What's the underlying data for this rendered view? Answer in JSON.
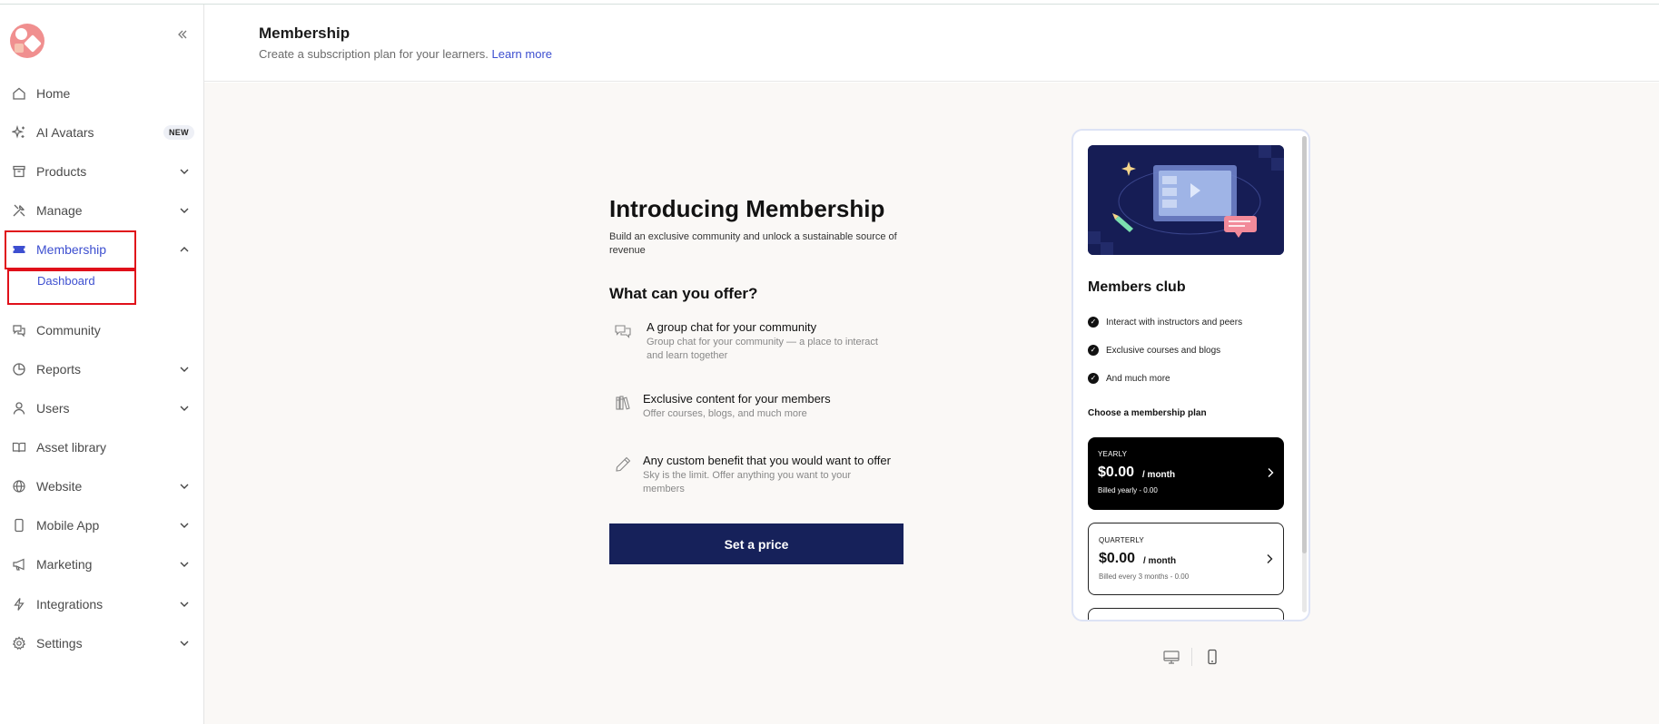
{
  "sidebar": {
    "collapse_icon": "double-chevron-left-icon",
    "items": [
      {
        "key": "home",
        "label": "Home",
        "icon": "home-icon"
      },
      {
        "key": "ai-avatars",
        "label": "AI Avatars",
        "icon": "sparkle-icon",
        "badge": "NEW"
      },
      {
        "key": "products",
        "label": "Products",
        "icon": "archive-box-icon"
      },
      {
        "key": "manage",
        "label": "Manage",
        "icon": "tools-icon"
      },
      {
        "key": "membership",
        "label": "Membership",
        "icon": "ticket-icon"
      },
      {
        "key": "community",
        "label": "Community",
        "icon": "chat-bubbles-icon"
      },
      {
        "key": "reports",
        "label": "Reports",
        "icon": "pie-chart-icon"
      },
      {
        "key": "users",
        "label": "Users",
        "icon": "user-icon"
      },
      {
        "key": "asset-library",
        "label": "Asset library",
        "icon": "book-icon"
      },
      {
        "key": "website",
        "label": "Website",
        "icon": "globe-icon"
      },
      {
        "key": "mobile-app",
        "label": "Mobile App",
        "icon": "phone-icon"
      },
      {
        "key": "marketing",
        "label": "Marketing",
        "icon": "megaphone-icon"
      },
      {
        "key": "integrations",
        "label": "Integrations",
        "icon": "lightning-icon"
      },
      {
        "key": "settings",
        "label": "Settings",
        "icon": "gear-icon"
      }
    ],
    "membership_sub": {
      "label": "Dashboard"
    }
  },
  "header": {
    "title": "Membership",
    "subtitle": "Create a subscription plan for your learners.",
    "learn_more": "Learn more"
  },
  "intro": {
    "title": "Introducing Membership",
    "description": "Build an exclusive community and unlock a sustainable source of revenue",
    "offer_title": "What can you offer?",
    "features": [
      {
        "title": "A group chat for your community",
        "desc": "Group chat for your community — a place to interact and learn together",
        "icon": "chat-bubbles-icon"
      },
      {
        "title": "Exclusive content for your members",
        "desc": "Offer courses, blogs, and much more",
        "icon": "books-icon"
      },
      {
        "title": "Any custom benefit that you would want to offer",
        "desc": "Sky is the limit. Offer anything you want to your members",
        "icon": "pencil-icon"
      }
    ],
    "cta": "Set a price"
  },
  "preview": {
    "title": "Members club",
    "perks": [
      "Interact with instructors and peers",
      "Exclusive courses and blogs",
      "And much more"
    ],
    "choose": "Choose a membership plan",
    "plans": [
      {
        "label": "YEARLY",
        "price": "$0.00",
        "period": "/ month",
        "billing": "Billed yearly - 0.00"
      },
      {
        "label": "QUARTERLY",
        "price": "$0.00",
        "period": "/ month",
        "billing": "Billed every 3 months - 0.00"
      }
    ]
  },
  "view_toggle": {
    "desktop_icon": "desktop-icon",
    "mobile_icon": "mobile-icon"
  },
  "colors": {
    "accent": "#3d4fd0",
    "cta": "#16215a",
    "highlight": "#e0101a",
    "main_bg": "#faf8f6"
  }
}
